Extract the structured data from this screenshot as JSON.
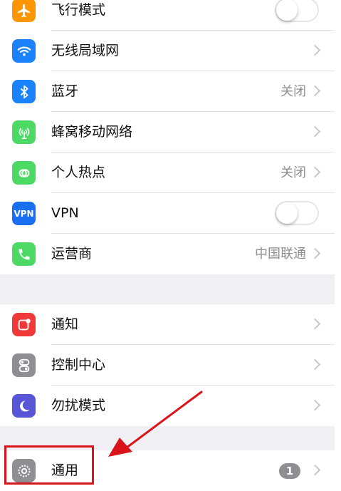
{
  "settings": {
    "group1": [
      {
        "label": "飞行模式",
        "icon": "airplane-icon",
        "color": "#ff9500",
        "control": "toggle",
        "state": "off"
      },
      {
        "label": "无线局域网",
        "icon": "wifi-icon",
        "color": "#1a82fb",
        "control": "chevron"
      },
      {
        "label": "蓝牙",
        "icon": "bluetooth-icon",
        "color": "#1a82fb",
        "value": "关闭",
        "control": "chevron"
      },
      {
        "label": "蜂窝移动网络",
        "icon": "cellular-icon",
        "color": "#4cd964",
        "control": "chevron"
      },
      {
        "label": "个人热点",
        "icon": "hotspot-icon",
        "color": "#4cd964",
        "value": "关闭",
        "control": "chevron"
      },
      {
        "label": "VPN",
        "icon": "vpn-icon",
        "icon_text": "VPN",
        "color": "#1a6ff0",
        "control": "toggle",
        "state": "off"
      },
      {
        "label": "运营商",
        "icon": "phone-icon",
        "color": "#4cd964",
        "value": "中国联通",
        "control": "chevron"
      }
    ],
    "group2": [
      {
        "label": "通知",
        "icon": "notification-icon",
        "color": "#f03a3a",
        "control": "chevron"
      },
      {
        "label": "控制中心",
        "icon": "control-center-icon",
        "color": "#8e8e93",
        "control": "chevron"
      },
      {
        "label": "勿扰模式",
        "icon": "moon-icon",
        "color": "#5856d6",
        "control": "chevron"
      }
    ],
    "group3": [
      {
        "label": "通用",
        "icon": "gear-icon",
        "color": "#8e8e93",
        "badge": "1",
        "control": "chevron"
      }
    ]
  },
  "annotation": {
    "highlight_color": "#d9141a"
  }
}
